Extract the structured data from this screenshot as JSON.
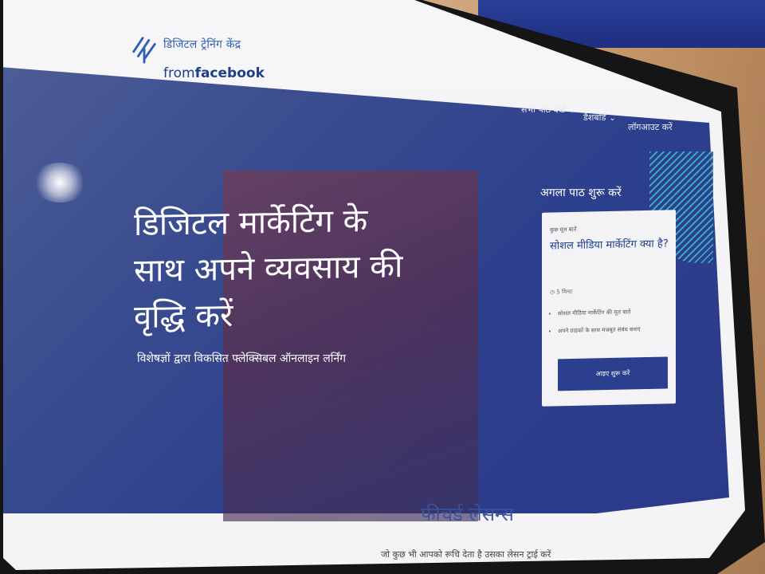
{
  "logo": {
    "line1": "डिजिटल ट्रेनिंग केंद्र",
    "line2_prefix": "from",
    "line2_brand": "facebook"
  },
  "nav": {
    "items": [
      {
        "label": "सभी पाठ देखें"
      },
      {
        "label": "डैशबोर्ड"
      },
      {
        "label": "लॉगआउट करें"
      }
    ]
  },
  "hero": {
    "headline": "डिजिटल मार्केटिंग के साथ अपने व्यवसाय की वृद्धि करें",
    "subhead": "विशेषज्ञों द्वारा विकसित फ्लेक्सिबल ऑनलाइन लर्निंग"
  },
  "next_lesson": {
    "label": "अगला पाठ शुरू करें",
    "card": {
      "kicker": "कुछ मूल बातें",
      "title": "सोशल मीडिया मार्केटिंग क्या है?",
      "duration": "5 मिनट",
      "bullets": [
        "सोशल मीडिया मार्केटिंग की मूल बातें",
        "अपने ग्राहकों के साथ मजबूत संबंध बनाएं"
      ],
      "button_label": "आइए शुरू करें"
    }
  },
  "featured": {
    "title": "फीचर्ड लेसन्स",
    "subtitle": "जो कुछ भी आपको रूचि देता है उसका लेसन ट्राई करें"
  },
  "colors": {
    "brand_blue": "#2c3f8f",
    "hero_bg": "#3a4c8f",
    "accent_teal": "#3fb6c6"
  }
}
